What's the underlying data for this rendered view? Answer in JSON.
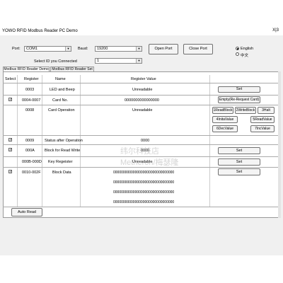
{
  "window": {
    "title": "YOWO RFID Modbus Reader PC Demo",
    "controls": "X|3"
  },
  "connection": {
    "port_label": "Port:",
    "port_value": "COM1",
    "baud_label": "Baud:",
    "baud_value": "19200",
    "open_port": "Open Port",
    "close_port": "Close Port",
    "select_id_label": "Select ID you Connected",
    "select_id_value": "1"
  },
  "language": {
    "english": "English",
    "chinese": "中文"
  },
  "tabs": [
    "Modbus RFID Reader Demo",
    "Modbus RFID Reader Set"
  ],
  "table": {
    "headers": {
      "select": "Select",
      "register": "Register",
      "name": "Name",
      "value": "Register Value"
    },
    "rows": [
      {
        "register": "0003",
        "name": "LED and Beep",
        "value": "Unreadable",
        "checked": false
      },
      {
        "register": "0004-0007",
        "name": "Card No.",
        "value": "0000000000000000",
        "checked": true
      },
      {
        "register": "0008",
        "name": "Card Operation",
        "value": "Unreadable",
        "checked": false
      },
      {
        "register": "0009",
        "name": "Status after Operation",
        "value": "0000",
        "checked": true
      },
      {
        "register": "000A",
        "name": "Block for Read Write",
        "value": "0000",
        "checked": true
      },
      {
        "register": "000B-000D",
        "name": "Key Regeister",
        "value": "Unreadable",
        "checked": false
      },
      {
        "register": "0010-002F",
        "name": "Block Data",
        "checked": true,
        "value_lines": [
          "0000000000000000000000000000000",
          "0000000000000000000000000000000",
          "0000000000000000000000000000000",
          "0000000000000000000000000000000"
        ]
      }
    ]
  },
  "buttons": {
    "set": "Set",
    "empty": "Empty(Re-Request Card)",
    "read_block": "1ReadBlock",
    "write_block": "2WriteBlock",
    "halt": "3Halt",
    "inita_value": "4InitaValue",
    "read_value": "5ReadValue",
    "dec_value": "6DecValue",
    "inc_value": "7IncValue",
    "auto_read": "Auto Read"
  },
  "watermark": {
    "line1": "纬尔科技店",
    "line2": "Metheron/梅瑟隆"
  }
}
